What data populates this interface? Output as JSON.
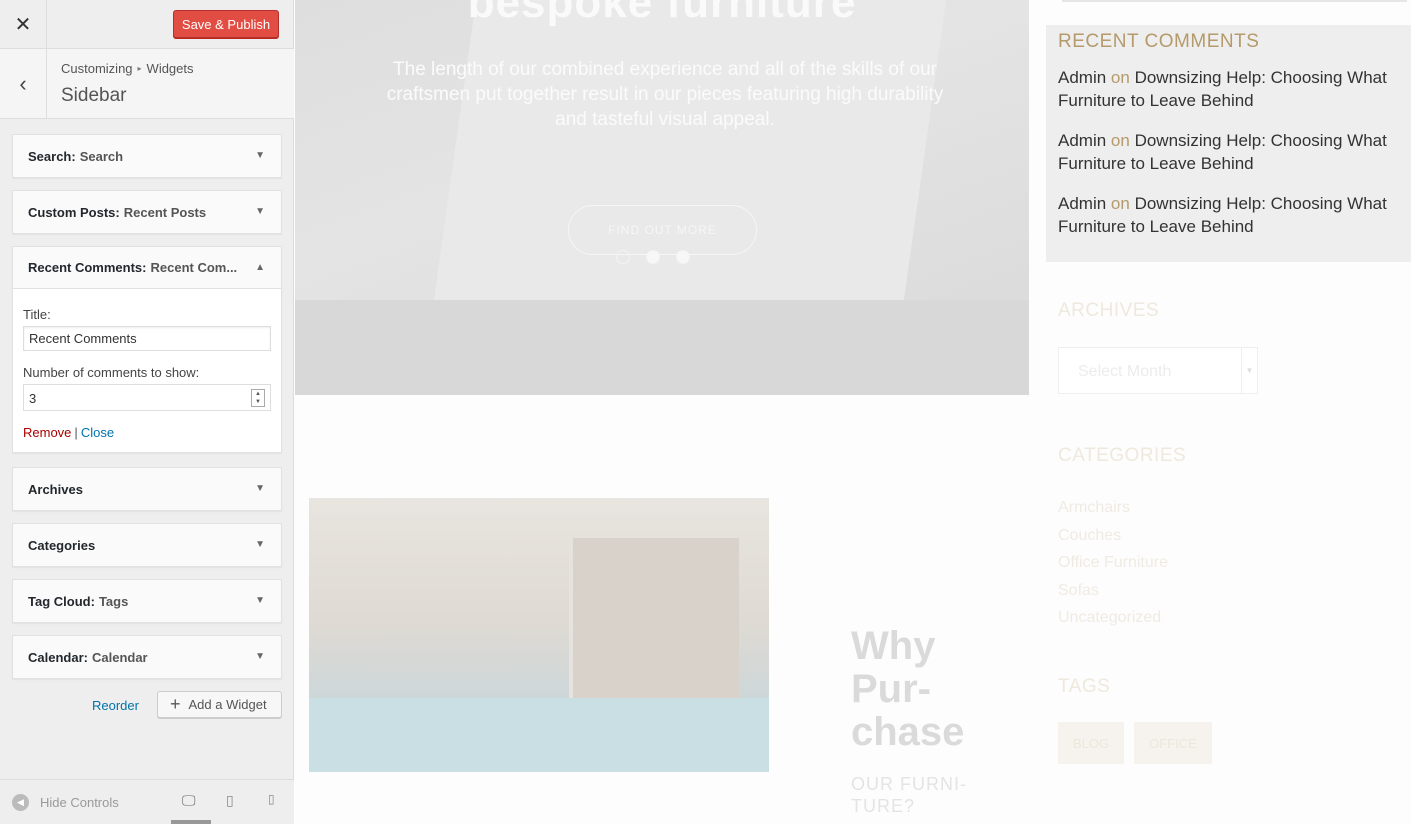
{
  "customizer": {
    "close_glyph": "✕",
    "save_label": "Save & Publish",
    "back_glyph": "‹",
    "breadcrumb": {
      "parent": "Customizing",
      "separator": "▸",
      "current": "Widgets"
    },
    "section_title": "Sidebar",
    "widgets": [
      {
        "name": "Search",
        "sep": ":",
        "subtitle": "Search"
      },
      {
        "name": "Custom Posts",
        "sep": ":",
        "subtitle": "Recent Posts"
      },
      {
        "name": "Recent Comments",
        "sep": ":",
        "subtitle": "Recent Com..."
      },
      {
        "name": "Archives",
        "sep": "",
        "subtitle": ""
      },
      {
        "name": "Categories",
        "sep": "",
        "subtitle": ""
      },
      {
        "name": "Tag Cloud",
        "sep": ":",
        "subtitle": "Tags"
      },
      {
        "name": "Calendar",
        "sep": ":",
        "subtitle": "Calendar"
      }
    ],
    "arrow_down": "▼",
    "arrow_up": "▲",
    "form": {
      "title_label": "Title:",
      "title_value": "Recent Comments",
      "number_label": "Number of comments to show:",
      "number_value": "3",
      "spin_up": "▲",
      "spin_down": "▼",
      "remove": "Remove",
      "pipe": "|",
      "close": "Close"
    },
    "reorder": "Reorder",
    "add_widget": "Add a Widget",
    "add_glyph": "+",
    "hide_controls": "Hide Controls",
    "hide_glyph": "◀",
    "devices": {
      "desktop": "🖵",
      "tablet": "▯",
      "mobile": "▯"
    }
  },
  "preview": {
    "hero_title": "bespoke furniture",
    "hero_text": "The length of our combined experience and all of the skills of our craftsmen put together result in our pieces featuring high durability and tasteful visual appeal.",
    "cta": "FIND OUT MORE",
    "why_lines": [
      "Why",
      "Pur-",
      "chase"
    ],
    "why_sub_lines": [
      "OUR FURNI-",
      "TURE?"
    ],
    "recent_comments": {
      "title": "RECENT COMMENTS",
      "items": [
        {
          "author": "Admin",
          "on": "on",
          "link": "Downsizing Help: Choosing What Furniture to Leave Behind"
        },
        {
          "author": "Admin",
          "on": "on",
          "link": "Downsizing Help: Choosing What Furniture to Leave Behind"
        },
        {
          "author": "Admin",
          "on": "on",
          "link": "Downsizing Help: Choosing What Furniture to Leave Behind"
        }
      ]
    },
    "archives": {
      "title": "ARCHIVES",
      "select": "Select Month",
      "caret": "▼"
    },
    "categories": {
      "title": "CATEGORIES",
      "items": [
        "Armchairs",
        "Couches",
        "Office Furniture",
        "Sofas",
        "Uncategorized"
      ]
    },
    "tags": {
      "title": "TAGS",
      "items": [
        "BLOG",
        "OFFICE"
      ]
    }
  },
  "colors": {
    "save": "#e14d43",
    "accent": "#b59a6b",
    "link": "#0073aa",
    "remove": "#aa0000"
  }
}
